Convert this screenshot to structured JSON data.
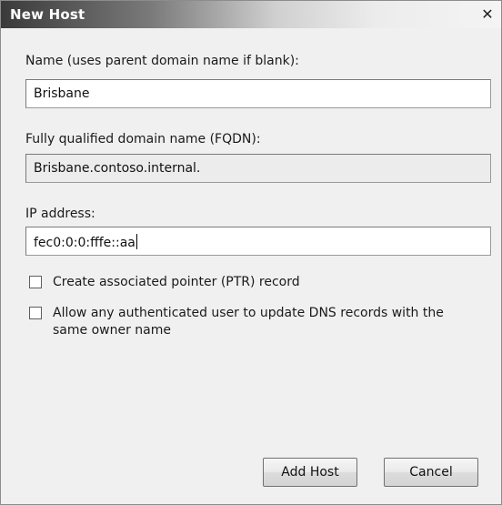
{
  "dialog": {
    "title": "New Host",
    "close_glyph": "✕"
  },
  "form": {
    "name_label": "Name (uses parent domain name if blank):",
    "name_value": "Brisbane",
    "fqdn_label": "Fully qualified domain name (FQDN):",
    "fqdn_value": "Brisbane.contoso.internal.",
    "ip_label": "IP address:",
    "ip_value": "fec0:0:0:fffe::aa"
  },
  "options": {
    "ptr_label": "Create associated pointer (PTR) record",
    "ptr_checked": false,
    "auth_label": "Allow any authenticated user to update DNS records with the same owner name",
    "auth_checked": false
  },
  "buttons": {
    "add_host": "Add Host",
    "cancel": "Cancel"
  }
}
